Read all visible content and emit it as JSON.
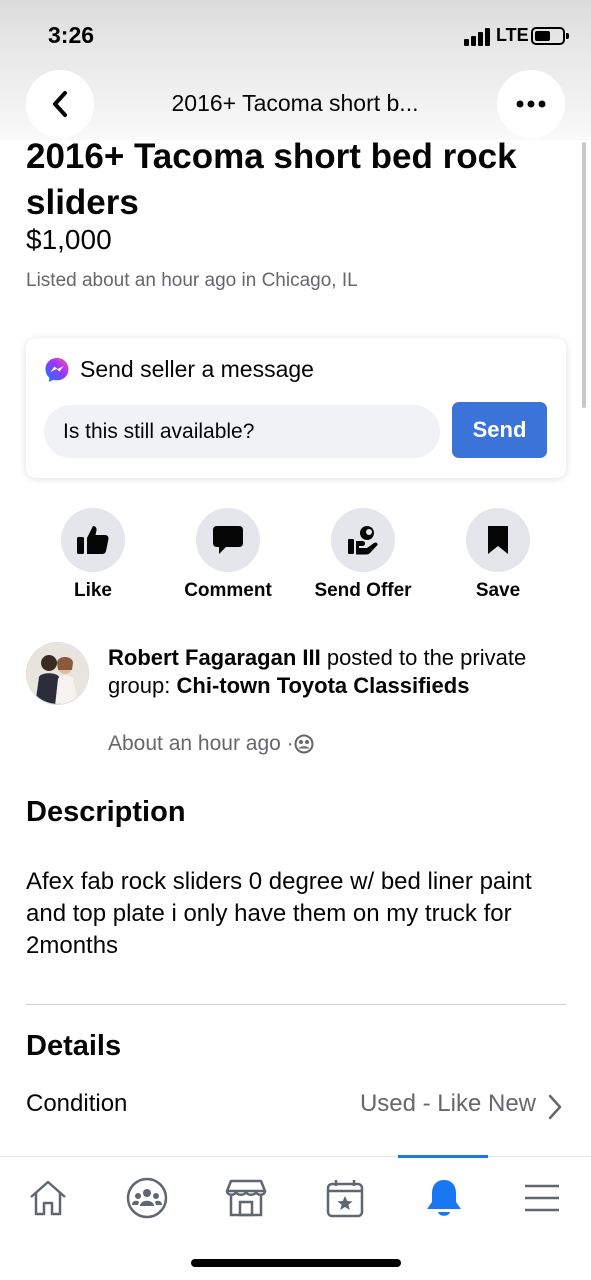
{
  "status": {
    "time": "3:26",
    "network": "LTE"
  },
  "header": {
    "title": "2016+ Tacoma short b..."
  },
  "listing": {
    "title": "2016+ Tacoma short bed rock sliders",
    "price": "$1,000",
    "listed": "Listed about an hour ago in Chicago, IL"
  },
  "message": {
    "heading": "Send seller a message",
    "input_value": "Is this still available?",
    "send_label": "Send"
  },
  "actions": [
    {
      "label": "Like",
      "icon": "thumbs-up-icon"
    },
    {
      "label": "Comment",
      "icon": "comment-icon"
    },
    {
      "label": "Send Offer",
      "icon": "offer-icon"
    },
    {
      "label": "Save",
      "icon": "bookmark-icon"
    }
  ],
  "post": {
    "author": "Robert Fagaragan III",
    "mid": " posted to the private group: ",
    "group": "Chi-town Toyota Classifieds",
    "time": "About an hour ago · "
  },
  "description": {
    "heading": "Description",
    "text": "Afex fab rock sliders 0 degree w/ bed liner paint and top plate i only have them on my truck for 2months"
  },
  "details": {
    "heading": "Details",
    "condition_label": "Condition",
    "condition_value": "Used - Like New"
  },
  "tabbar": {
    "tabs": [
      "home-icon",
      "groups-icon",
      "marketplace-icon",
      "pages-icon",
      "notifications-icon",
      "menu-icon"
    ],
    "active": "notifications-icon",
    "accent": "#1877f2"
  },
  "colors": {
    "send_button": "#3b73d9",
    "secondary_text": "#65676b"
  }
}
